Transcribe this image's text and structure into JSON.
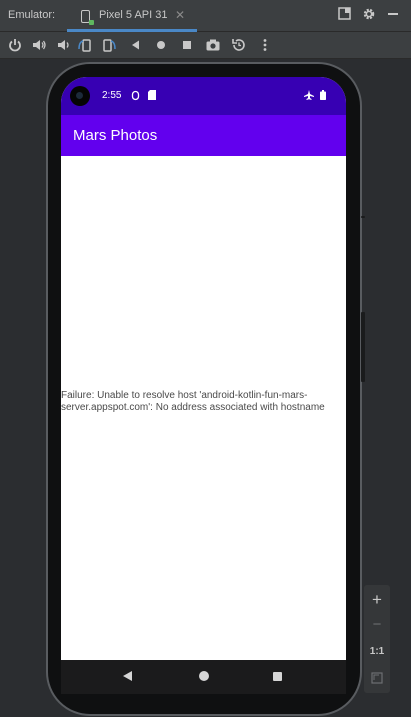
{
  "ide": {
    "panel_label": "Emulator:",
    "device_tab": "Pixel 5 API 31",
    "tab_close_icon": "close-icon",
    "right_icons": [
      "restore-window-icon",
      "gear-icon",
      "minimize-icon"
    ]
  },
  "toolbar": {
    "items": [
      "power-icon",
      "volume-up-icon",
      "volume-down-icon",
      "rotate-left-icon",
      "rotate-right-icon",
      "back-icon",
      "home-icon",
      "overview-icon",
      "camera-icon",
      "snapshot-icon",
      "more-icon"
    ]
  },
  "phone": {
    "status_bar": {
      "time": "2:55",
      "icons": [
        "location-icon",
        "sim-card-icon",
        "airplane-icon",
        "battery-icon"
      ]
    },
    "app_title": "Mars Photos",
    "error_message": "Failure: Unable to resolve host 'android-kotlin-fun-mars-server.appspot.com': No address associated with hostname",
    "nav_icons": [
      "back-triangle-icon",
      "home-circle-icon",
      "recents-square-icon"
    ]
  },
  "zoom": {
    "plus": "+",
    "minus": "−",
    "one_to_one": "1:1",
    "fit_icon": "fit-screen-icon"
  },
  "colors": {
    "status_bar": "#3700b3",
    "app_bar": "#6200ee",
    "ide_bg": "#2b2d30",
    "tab_accent": "#4a88c7"
  }
}
